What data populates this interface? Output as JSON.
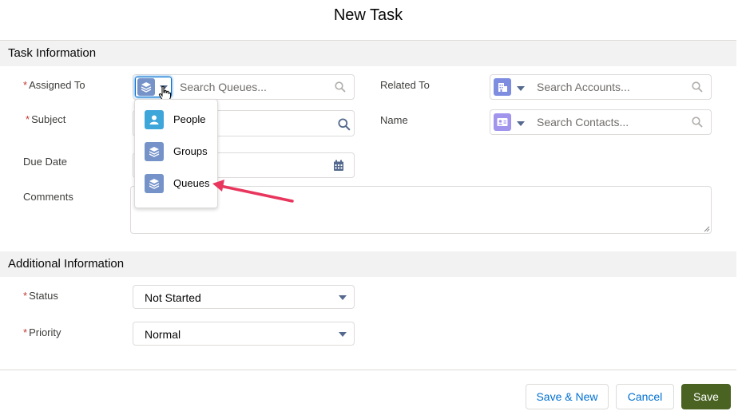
{
  "modal": {
    "title": "New Task"
  },
  "sections": {
    "task_info": "Task Information",
    "additional_info": "Additional Information"
  },
  "fields": {
    "assigned_to": {
      "label": "Assigned To",
      "required": "*",
      "placeholder": "Search Queues..."
    },
    "subject": {
      "label": "Subject",
      "required": "*"
    },
    "due_date": {
      "label": "Due Date"
    },
    "comments": {
      "label": "Comments"
    },
    "related_to": {
      "label": "Related To",
      "placeholder": "Search Accounts..."
    },
    "name": {
      "label": "Name",
      "placeholder": "Search Contacts..."
    },
    "status": {
      "label": "Status",
      "required": "*",
      "value": "Not Started"
    },
    "priority": {
      "label": "Priority",
      "required": "*",
      "value": "Normal"
    }
  },
  "assignee_menu": {
    "items": [
      {
        "label": "People",
        "icon": "person-icon",
        "color": "#3fa6da"
      },
      {
        "label": "Groups",
        "icon": "layers-icon",
        "color": "#7593c9"
      },
      {
        "label": "Queues",
        "icon": "layers-icon",
        "color": "#7593c9"
      }
    ]
  },
  "footer": {
    "save_new": "Save & New",
    "cancel": "Cancel",
    "save": "Save"
  },
  "colors": {
    "brand_save": "#4a6322",
    "link": "#0070d2",
    "required": "#c23934",
    "account_icon": "#7f8de1",
    "contact_icon": "#a094ed",
    "queue_icon": "#7593c9",
    "annotation_arrow": "#e8365d"
  }
}
